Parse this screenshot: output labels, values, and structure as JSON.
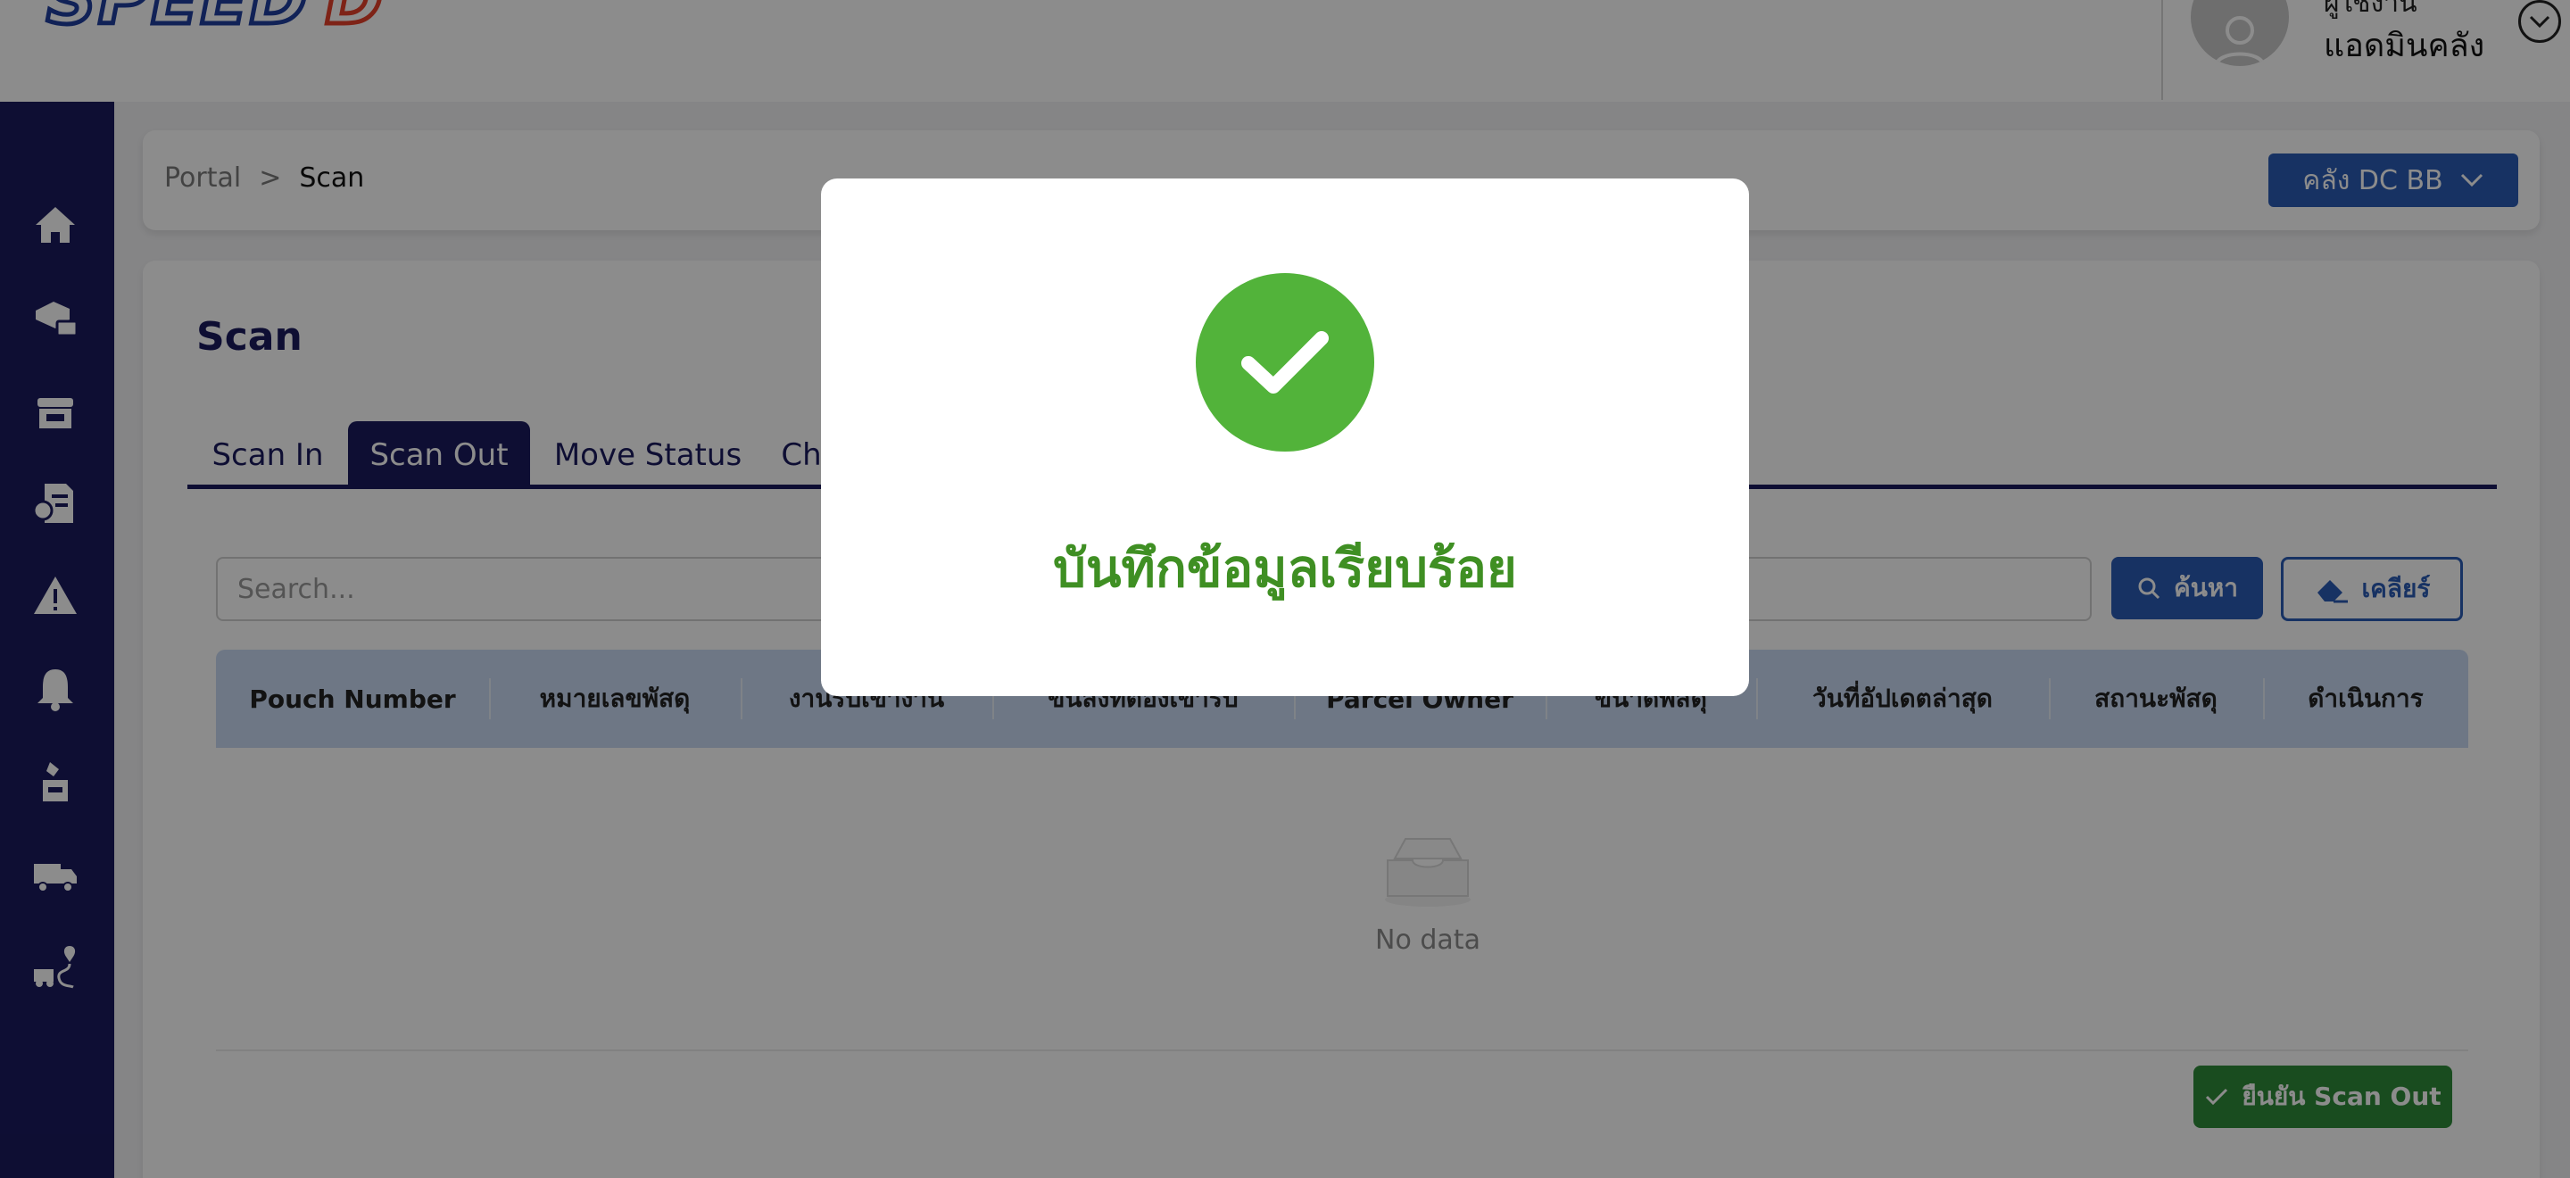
{
  "header": {
    "logo_text": "SPEED",
    "logo_text_2": "D",
    "user_name": "ผู้ใช้งาน",
    "user_role": "แอดมินคลัง"
  },
  "breadcrumb": {
    "portal": "Portal",
    "separator": ">",
    "current": "Scan"
  },
  "warehouse_selector": {
    "label": "คลัง DC BB"
  },
  "page": {
    "title": "Scan"
  },
  "tabs": [
    {
      "label": "Scan In",
      "active": false
    },
    {
      "label": "Scan Out",
      "active": true
    },
    {
      "label": "Move Status",
      "active": false
    },
    {
      "label": "Ch",
      "active": false
    }
  ],
  "search": {
    "placeholder": "Search...",
    "value": "",
    "search_label": "ค้นหา",
    "clear_label": "เคลียร์"
  },
  "table": {
    "columns": [
      "Pouch Number",
      "หมายเลขพัสดุ",
      "งานรับเข้างาน",
      "ขนส่งที่ต้องเข้ารับ",
      "Parcel Owner",
      "ขนาดพัสดุ",
      "วันที่อัปเดตล่าสุด",
      "สถานะพัสดุ",
      "ดำเนินการ"
    ],
    "rows": [],
    "empty_text": "No data"
  },
  "actions": {
    "confirm_label": "ยืนยัน Scan Out"
  },
  "modal": {
    "message": "บันทึกข้อมูลเรียบร้อย",
    "icon": "check-circle-icon"
  },
  "colors": {
    "sidebar": "#1a1a5e",
    "primary": "#2a5bb5",
    "success": "#52b33a",
    "confirm": "#2f8a3a",
    "table_header": "#c9d9f2"
  }
}
